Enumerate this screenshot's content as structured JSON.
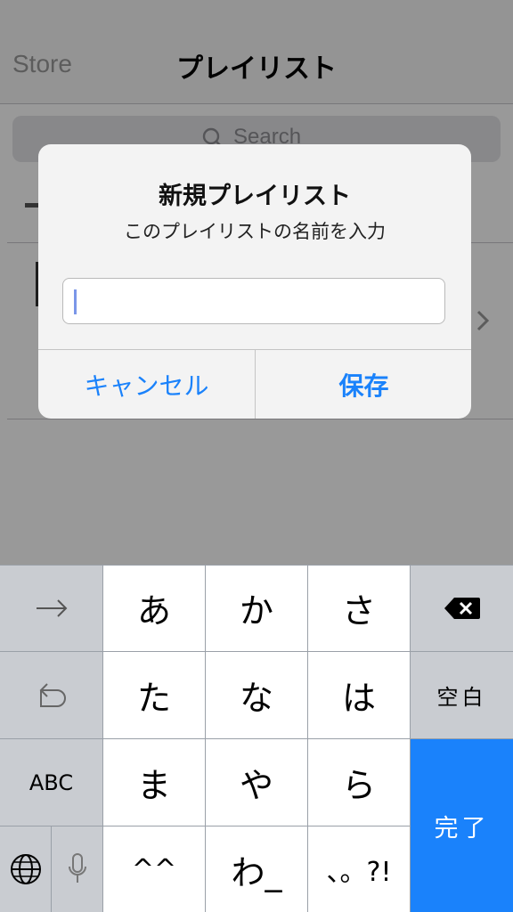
{
  "background": {
    "nav_back_label": "Store",
    "nav_title": "プレイリスト",
    "search_placeholder": "Search"
  },
  "alert": {
    "title": "新規プレイリスト",
    "message": "このプレイリストの名前を入力",
    "input_value": "",
    "cancel_label": "キャンセル",
    "save_label": "保存"
  },
  "keyboard": {
    "row1": [
      "あ",
      "か",
      "さ"
    ],
    "row2": [
      "た",
      "な",
      "は"
    ],
    "row3": [
      "ま",
      "や",
      "ら"
    ],
    "row4": [
      "^^",
      "わ_",
      "、。?!"
    ],
    "space_label": "空白",
    "abc_label": "ABC",
    "done_label": "完了"
  },
  "colors": {
    "accent": "#1a82fb",
    "key_white": "#ffffff",
    "key_gray": "#c9ccd1"
  },
  "icons": [
    "search-icon",
    "chevron-right-icon",
    "arrow-right-icon",
    "undo-icon",
    "delete-icon",
    "globe-icon",
    "microphone-icon"
  ]
}
